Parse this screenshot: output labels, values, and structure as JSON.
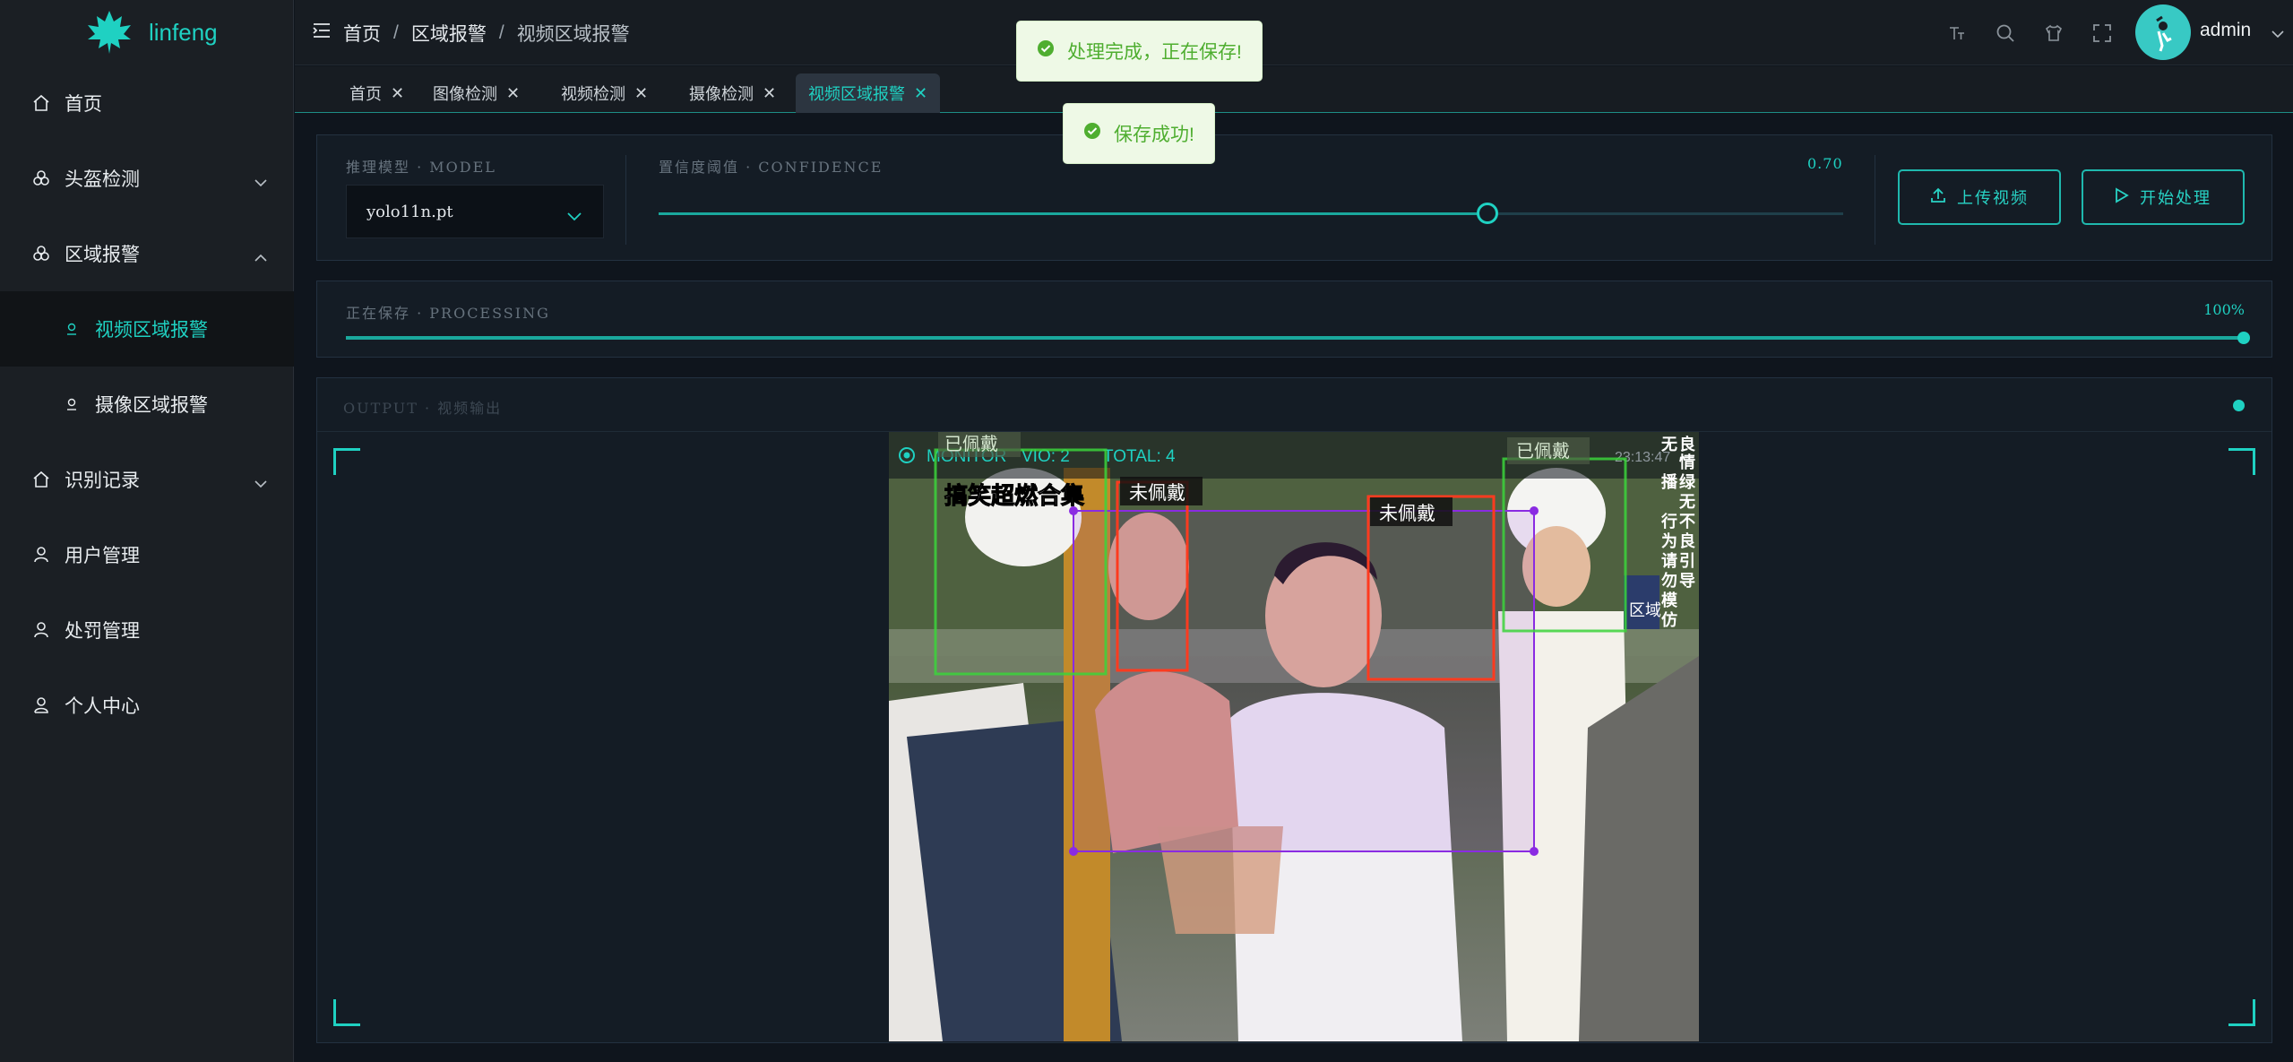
{
  "app": {
    "name": "linfeng"
  },
  "sidebar": {
    "items": [
      {
        "label": "首页",
        "icon": "home-icon"
      },
      {
        "label": "头盔检测",
        "icon": "helmet-icon",
        "expandable": true
      },
      {
        "label": "区域报警",
        "icon": "area-icon",
        "expandable": true,
        "expanded": true
      },
      {
        "label": "视频区域报警",
        "icon": "camera-icon",
        "sub": true,
        "active": true
      },
      {
        "label": "摄像区域报警",
        "icon": "camera-icon",
        "sub": true
      },
      {
        "label": "识别记录",
        "icon": "record-icon",
        "expandable": true
      },
      {
        "label": "用户管理",
        "icon": "user-icon"
      },
      {
        "label": "处罚管理",
        "icon": "penalty-icon"
      },
      {
        "label": "个人中心",
        "icon": "profile-icon"
      }
    ]
  },
  "header": {
    "breadcrumb": [
      "首页",
      "区域报警",
      "视频区域报警"
    ],
    "user": "admin"
  },
  "tabs": [
    {
      "label": "首页"
    },
    {
      "label": "图像检测"
    },
    {
      "label": "视频检测"
    },
    {
      "label": "摄像检测"
    },
    {
      "label": "视频区域报警",
      "active": true
    }
  ],
  "controls": {
    "model_label": "推理模型 · MODEL",
    "model_value": "yolo11n.pt",
    "confidence_label": "置信度阈值 · CONFIDENCE",
    "confidence_value": "0.70",
    "confidence_level": 0.7,
    "upload_label": "上传视频",
    "start_label": "开始处理"
  },
  "progress": {
    "label": "正在保存 · PROCESSING",
    "value_text": "100%",
    "fraction": 1.0
  },
  "output": {
    "label": "OUTPUT · 视频输出"
  },
  "video": {
    "hud": {
      "monitor": "MONITOR",
      "vio": "VIO: 2",
      "total": "TOTAL: 4",
      "time": "23:13:47"
    },
    "caption": "搞笑超燃合集",
    "detections": [
      {
        "label": "已佩戴",
        "color": "#3bd43b"
      },
      {
        "label": "未佩戴",
        "color": "#ff3b1f"
      },
      {
        "label": "未佩戴",
        "color": "#ff3b1f"
      },
      {
        "label": "已佩戴",
        "color": "#3bd43b"
      }
    ],
    "side_text": [
      "无",
      "良",
      "情",
      "播",
      "绿",
      "无",
      "不",
      "良",
      "引",
      "导",
      "行",
      "为",
      "请",
      "勿",
      "模",
      "仿"
    ],
    "sign_text": "区域"
  },
  "toasts": [
    {
      "text": "处理完成，正在保存!"
    },
    {
      "text": "保存成功!"
    }
  ],
  "colors": {
    "accent": "#1fd1c2",
    "sidebar_bg": "#1b1f24",
    "page_bg": "#0f151d",
    "success": "#4fae30",
    "zone": "#8a2be2"
  }
}
